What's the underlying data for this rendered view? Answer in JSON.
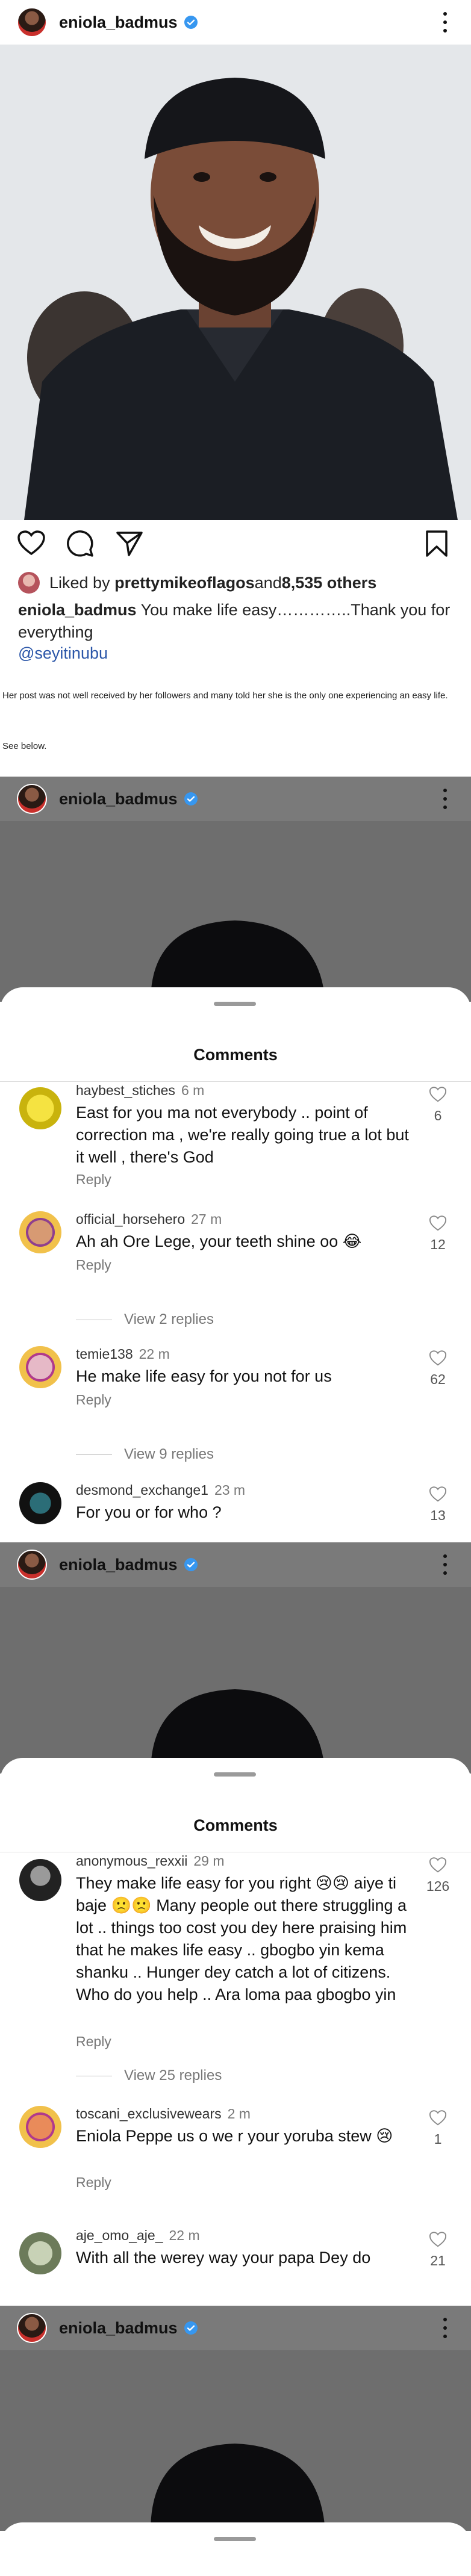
{
  "account": {
    "username": "eniola_badmus"
  },
  "post": {
    "liked_by_prefix": "Liked by ",
    "liked_by_user": "prettymikeoflagos",
    "liked_by_suffix": " and ",
    "likes_count": "8,535 others",
    "caption_user": "eniola_badmus",
    "caption_text": " You make life easy…………..Thank you for everything",
    "mention": "@seyitinubu"
  },
  "article": {
    "note": "Her post was not well received by her followers and many told her she is the only one experiencing an easy life.",
    "see_below": "See below."
  },
  "comments_sheet": {
    "title": "Comments"
  },
  "screen2_comments": [
    {
      "user": "haybest_stiches",
      "time": "6 m",
      "text": "East for you ma not everybody .. point of correction ma , we're really going true a lot but it well , there's God",
      "reply": "Reply",
      "likes": "6",
      "view_replies": ""
    },
    {
      "user": "official_horsehero",
      "time": "27 m",
      "text": "Ah ah Ore Lege, your teeth shine oo 😂",
      "reply": "Reply",
      "likes": "12",
      "view_replies": "View 2 replies"
    },
    {
      "user": "temie138",
      "time": "22 m",
      "text": "He make life easy for you not for us",
      "reply": "Reply",
      "likes": "62",
      "view_replies": "View 9 replies"
    },
    {
      "user": "desmond_exchange1",
      "time": "23 m",
      "text": "For you or for who ?",
      "reply": "",
      "likes": "13",
      "view_replies": ""
    }
  ],
  "screen3_comments": [
    {
      "user": "anonymous_rexxii",
      "time": "29 m",
      "text": "They make life easy for you right 😢😢 aiye ti baje 🙁🙁 Many people out there struggling a lot .. things too cost you dey here praising him  that he makes life easy .. gbogbo yin kema shanku .. Hunger dey catch a lot of citizens. Who do you help .. Ara loma paa gbogbo yin",
      "reply": "Reply",
      "likes": "126",
      "view_replies": "View 25 replies"
    },
    {
      "user": "toscani_exclusivewears",
      "time": "2 m",
      "text": "Eniola Peppe us o we r your yoruba stew 😢",
      "reply": "Reply",
      "likes": "1",
      "view_replies": ""
    },
    {
      "user": "aje_omo_aje_",
      "time": "22 m",
      "text": "With all the werey way your papa Dey do",
      "reply": "",
      "likes": "21",
      "view_replies": ""
    }
  ],
  "colors": {
    "verified": "#3797f0",
    "link": "#2b56a8",
    "sheet_dim": "#7a7a7a"
  },
  "icons": [
    "verified-badge-icon",
    "more-options-icon",
    "heart-icon",
    "comment-icon",
    "share-icon",
    "bookmark-icon"
  ]
}
